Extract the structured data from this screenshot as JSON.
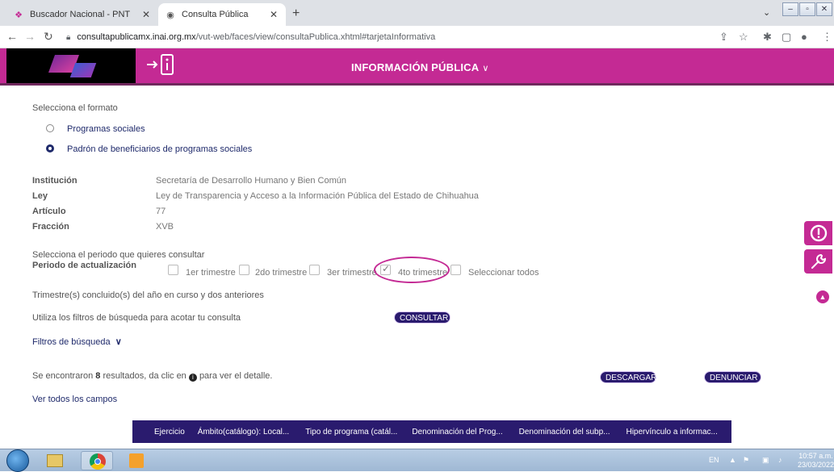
{
  "browser": {
    "tabs": [
      {
        "title": "Buscador Nacional - PNT"
      },
      {
        "title": "Consulta Pública"
      }
    ],
    "address": {
      "host": "consultapublicamx.inai.org.mx",
      "path": "/vut-web/faces/view/consultaPublica.xhtml#tarjetaInformativa"
    }
  },
  "header": {
    "title": "INFORMACIÓN PÚBLICA",
    "title_chevron": "∨"
  },
  "format": {
    "prompt": "Selecciona el formato",
    "options": [
      {
        "label": "Programas sociales",
        "selected": false
      },
      {
        "label": "Padrón de beneficiarios de programas sociales",
        "selected": true
      }
    ]
  },
  "details": [
    {
      "label": "Institución",
      "value": "Secretaría de Desarrollo Humano y Bien Común"
    },
    {
      "label": "Ley",
      "value": "Ley de Transparencia y Acceso a la Información Pública del Estado de Chihuahua"
    },
    {
      "label": "Artículo",
      "value": "77"
    },
    {
      "label": "Fracción",
      "value": "XVB"
    }
  ],
  "period": {
    "prompt": "Selecciona el periodo que quieres consultar",
    "label": "Periodo de actualización",
    "options": [
      {
        "label": "1er trimestre",
        "checked": false
      },
      {
        "label": "2do trimestre",
        "checked": false
      },
      {
        "label": "3er trimestre",
        "checked": false
      },
      {
        "label": "4to trimestre",
        "checked": true
      },
      {
        "label": "Seleccionar todos",
        "checked": false
      }
    ],
    "note": "Trimestre(s) concluido(s) del año en curso y dos anteriores"
  },
  "filters": {
    "hint": "Utiliza los filtros de búsqueda para acotar tu consulta",
    "consult_button": "CONSULTAR",
    "toggle_label": "Filtros de búsqueda"
  },
  "results": {
    "prefix": "Se encontraron",
    "count": "8",
    "middle": "resultados, da clic en",
    "suffix": "para ver el detalle.",
    "download_button": "DESCARGAR",
    "report_button": "DENUNCIAR",
    "all_fields_link": "Ver todos los campos"
  },
  "table": {
    "columns": [
      "Ejercicio",
      "Ámbito(catálogo): Local...",
      "Tipo de programa (catál...",
      "Denominación del Prog...",
      "Denominación del subp...",
      "Hipervínculo a informac..."
    ]
  },
  "taskbar": {
    "lang": "EN",
    "time": "10:57 a.m.",
    "date": "23/03/2022"
  },
  "colors": {
    "brand_magenta": "#c42a94",
    "brand_navy": "#2a1b6e"
  }
}
